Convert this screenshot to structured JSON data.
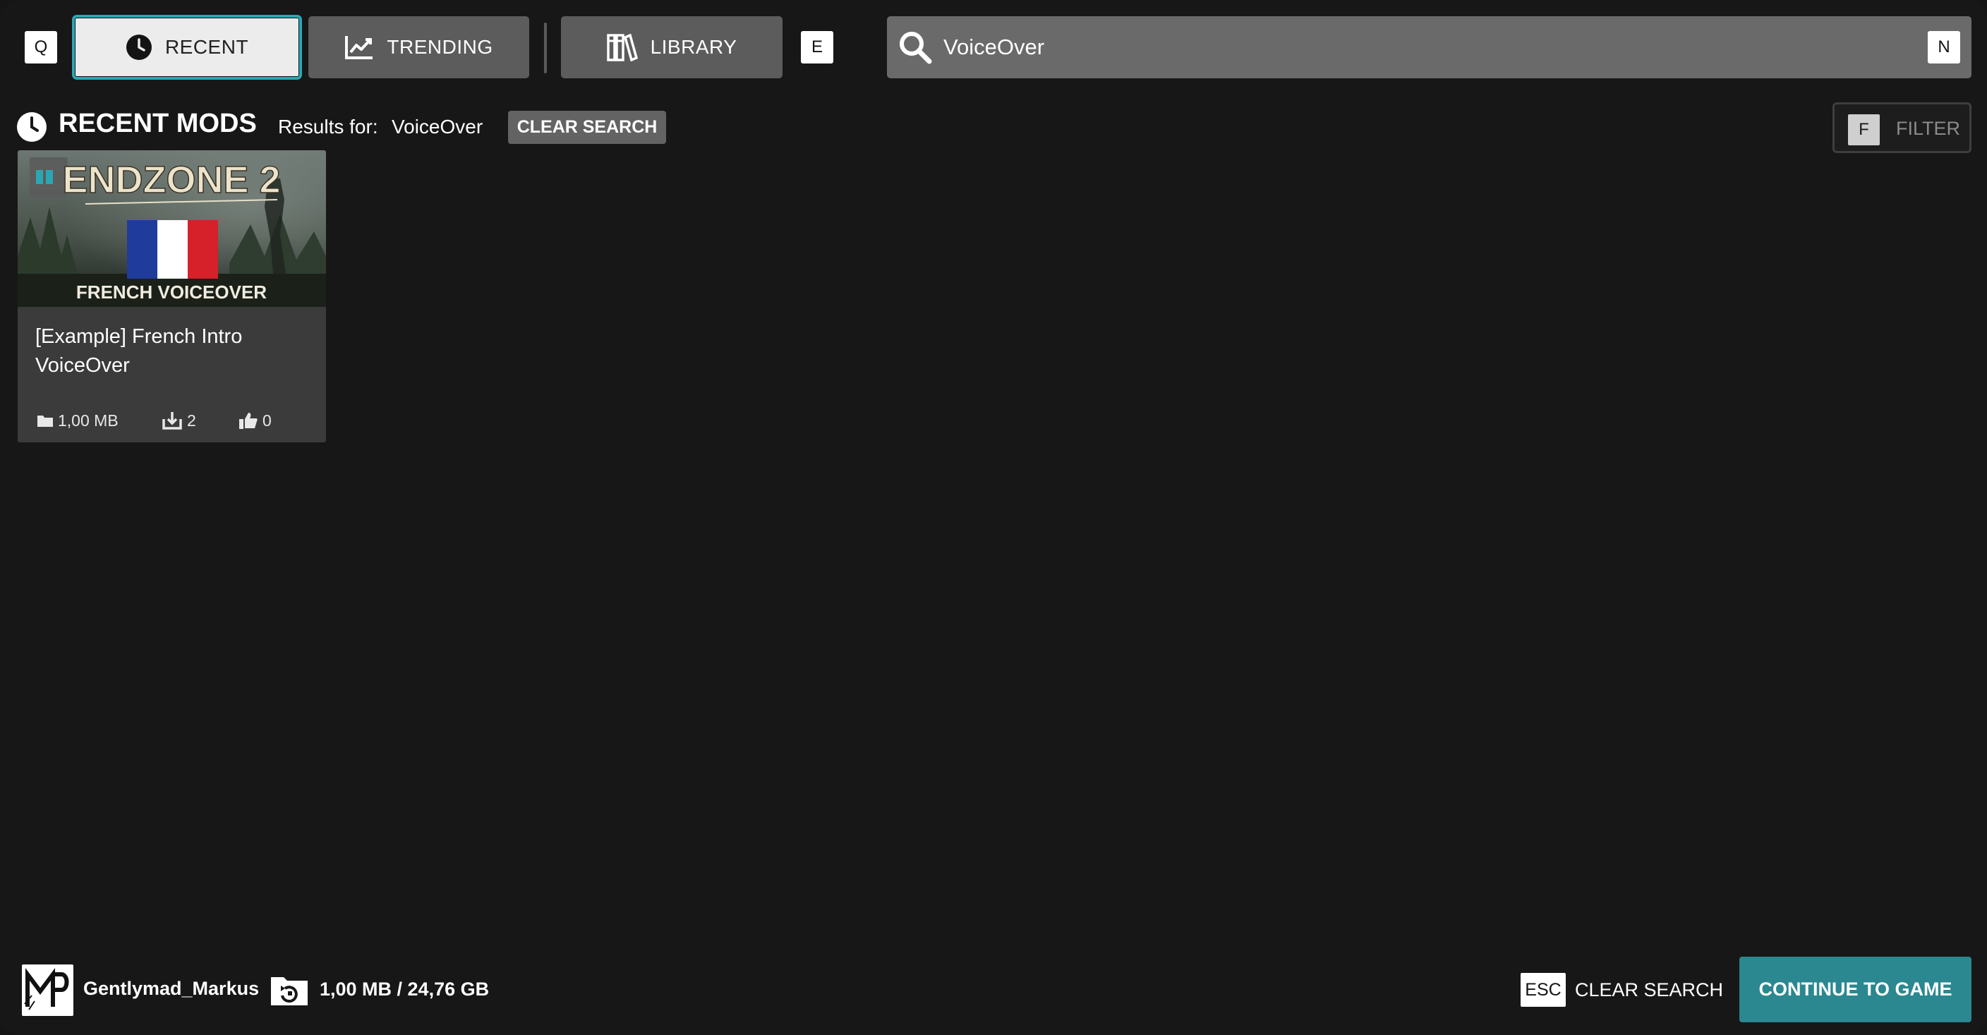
{
  "nav": {
    "prev_key": "Q",
    "next_key": "E",
    "tabs": [
      {
        "label": "RECENT",
        "icon": "clock-icon",
        "active": true
      },
      {
        "label": "TRENDING",
        "icon": "trending-chart-icon",
        "active": false
      },
      {
        "label": "LIBRARY",
        "icon": "library-books-icon",
        "active": false
      }
    ]
  },
  "search": {
    "value": "VoiceOver",
    "key_hint": "N",
    "icon": "search-icon"
  },
  "section": {
    "icon": "clock-icon",
    "title": "RECENT MODS",
    "results_label": "Results for:",
    "results_query": "VoiceOver",
    "clear_chip": "CLEAR SEARCH"
  },
  "filter": {
    "key": "F",
    "label": "FILTER"
  },
  "mods": [
    {
      "thumb_title": "ENDZONE 2",
      "thumb_caption": "FRENCH VOICEOVER",
      "title": "[Example] French Intro VoiceOver",
      "size": "1,00 MB",
      "downloads": "2",
      "likes": "0"
    }
  ],
  "footer": {
    "avatar_text": "MP",
    "username": "Gentlymad_Markus",
    "storage": "1,00 MB / 24,76 GB",
    "esc_key": "ESC",
    "esc_label": "CLEAR SEARCH",
    "continue_label": "CONTINUE TO GAME"
  },
  "colors": {
    "background": "#171717",
    "accent": "#2aa7b3",
    "continue_button": "#2b8790",
    "tab_inactive": "#5c5c5c",
    "tab_active": "#ececec",
    "card": "#3b3b3b",
    "flag_blue": "#1f3c9c",
    "flag_white": "#ffffff",
    "flag_red": "#d6202a"
  }
}
